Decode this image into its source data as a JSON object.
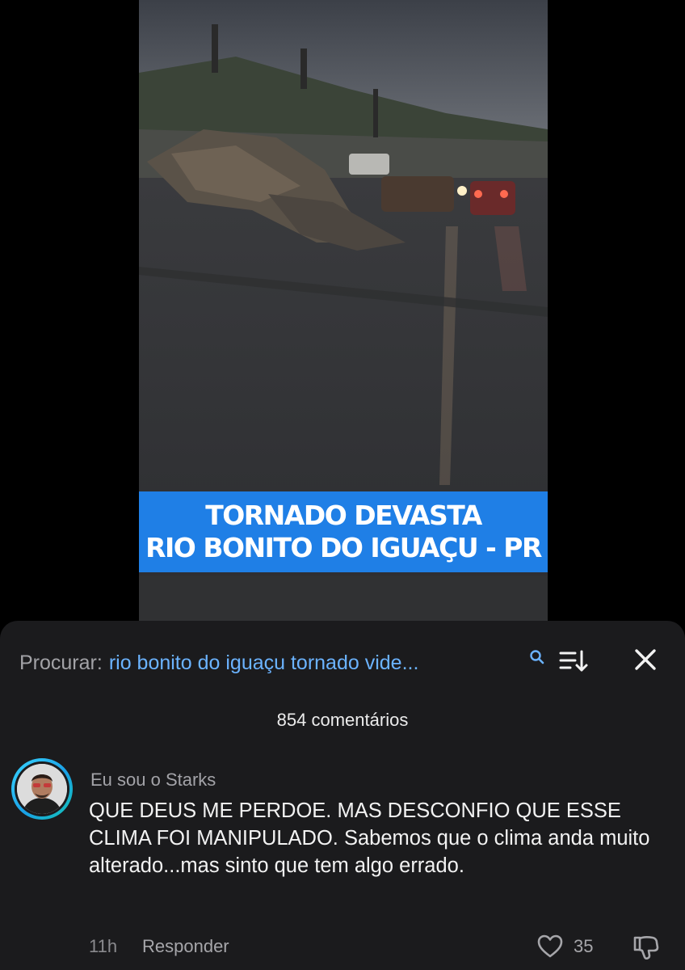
{
  "video": {
    "caption_line1": "TORNADO DEVASTA",
    "caption_line2": "RIO BONITO DO IGUAÇU - PR",
    "caption_bg": "#1f7fe6"
  },
  "search": {
    "prefix": "Procurar:",
    "query": "rio bonito do iguaçu tornado vide...",
    "query_color": "#6bb3ff",
    "icons": [
      "search-icon",
      "sort-icon",
      "close-icon"
    ]
  },
  "comments": {
    "count_label": "854 comentários",
    "items": [
      {
        "username": "Eu sou o Starks",
        "text": "QUE DEUS ME PERDOE. MAS DESCONFIO QUE ESSE CLIMA FOI MANIPULADO. Sabemos que o clima anda muito alterado...mas sinto que tem algo errado.",
        "time": "11h",
        "reply_label": "Responder",
        "likes": "35"
      }
    ]
  }
}
